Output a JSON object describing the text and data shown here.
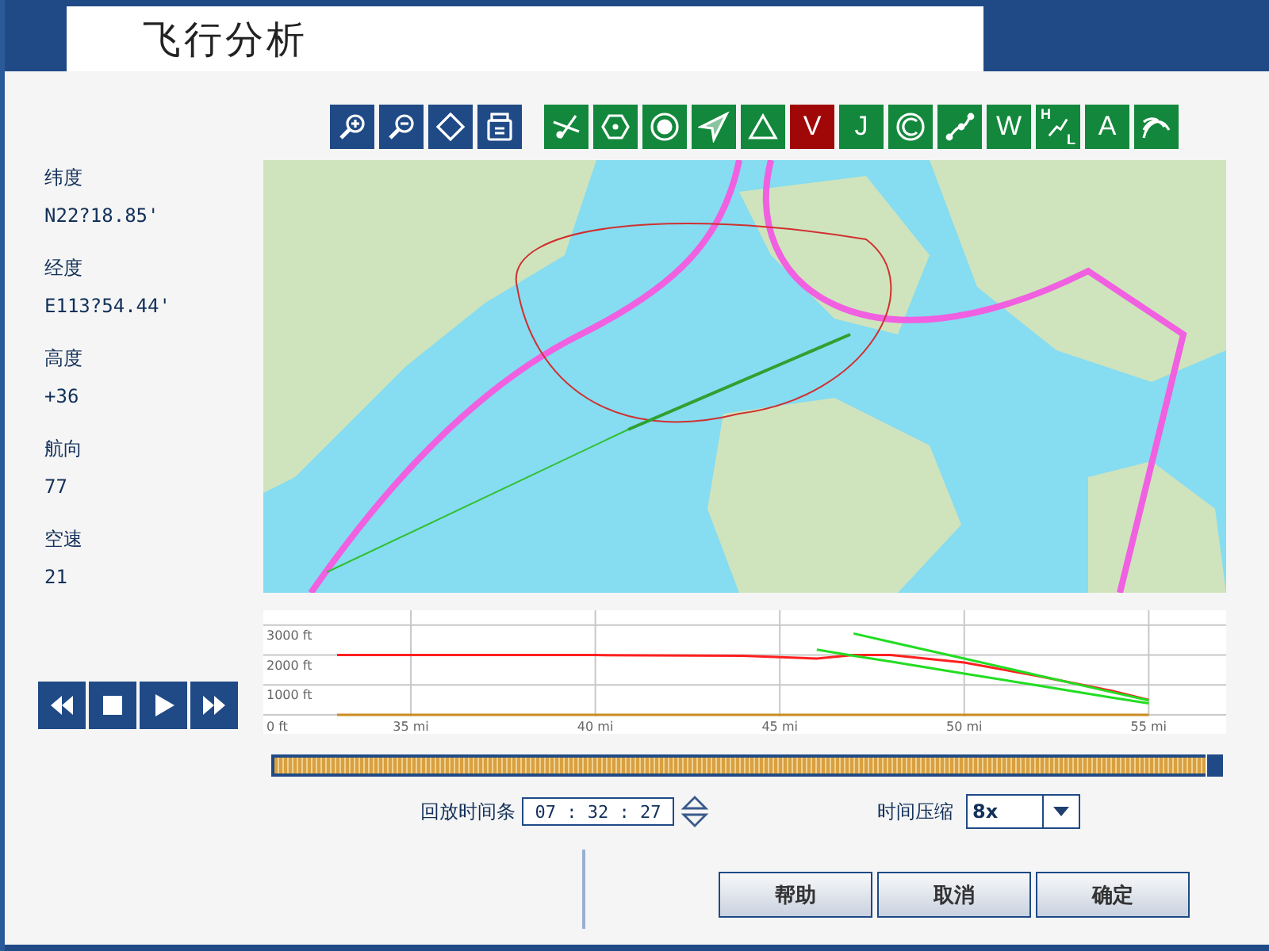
{
  "window": {
    "title": "飞行分析"
  },
  "zoom_tools": [
    {
      "kind": "zoom-in"
    },
    {
      "kind": "zoom-out"
    },
    {
      "kind": "diamond"
    },
    {
      "kind": "print"
    }
  ],
  "layer_filters": [
    {
      "kind": "icon",
      "selected": false
    },
    {
      "kind": "icon",
      "selected": false
    },
    {
      "kind": "icon",
      "selected": false
    },
    {
      "kind": "icon",
      "selected": false
    },
    {
      "kind": "icon",
      "selected": false
    },
    {
      "kind": "letter",
      "label": "V",
      "selected": true
    },
    {
      "kind": "letter",
      "label": "J",
      "selected": false
    },
    {
      "kind": "icon",
      "selected": false
    },
    {
      "kind": "icon",
      "selected": false
    },
    {
      "kind": "letter",
      "label": "W",
      "selected": false
    },
    {
      "kind": "hl",
      "top": "H",
      "bottom": "L",
      "selected": false
    },
    {
      "kind": "letter",
      "label": "A",
      "selected": false
    },
    {
      "kind": "icon",
      "selected": false
    }
  ],
  "readouts": [
    {
      "label": "纬度",
      "value": "N22?18.85'"
    },
    {
      "label": "经度",
      "value": "E113?54.44'"
    },
    {
      "label": "高度",
      "value": "+36"
    },
    {
      "label": "航向",
      "value": "77"
    },
    {
      "label": "空速",
      "value": "21"
    }
  ],
  "profile": {
    "chart_data": {
      "type": "line",
      "xlim": [
        31,
        57.1
      ],
      "ylim": [
        0,
        3500
      ],
      "xticks": [
        {
          "value": 35,
          "label": "35 mi"
        },
        {
          "value": 40,
          "label": "40 mi"
        },
        {
          "value": 45,
          "label": "45 mi"
        },
        {
          "value": 50,
          "label": "50 mi"
        },
        {
          "value": 55,
          "label": "55 mi"
        }
      ],
      "yticks": [
        {
          "value": 0,
          "label": "0 ft"
        },
        {
          "value": 1000,
          "label": "1000 ft"
        },
        {
          "value": 2000,
          "label": "2000 ft"
        },
        {
          "value": 3000,
          "label": "3000 ft"
        }
      ],
      "grid": true,
      "x": [
        33,
        35,
        40,
        44,
        46,
        47,
        48,
        50,
        52,
        54,
        55
      ],
      "series": [
        {
          "color": "#ff2020",
          "values": [
            2000,
            2000,
            2000,
            1980,
            1880,
            2000,
            2000,
            1750,
            1300,
            800,
            500
          ]
        },
        {
          "color": "#22dd22",
          "values": [
            null,
            null,
            null,
            null,
            null,
            2720,
            2440,
            1880,
            1320,
            760,
            480
          ]
        },
        {
          "color": "#22dd22",
          "values": [
            null,
            null,
            null,
            null,
            2180,
            1980,
            1780,
            1380,
            980,
            580,
            380
          ]
        },
        {
          "color": "#cc8a20",
          "values": [
            0,
            0,
            0,
            0,
            0,
            0,
            0,
            0,
            0,
            0,
            0
          ]
        }
      ]
    }
  },
  "timeline": {
    "level": 1.0
  },
  "playback": {
    "label": "回放时间条",
    "time": "07 : 32 : 27"
  },
  "compression": {
    "label": "时间压缩",
    "value": "8x"
  },
  "buttons": [
    "帮助",
    "取消",
    "确定"
  ]
}
